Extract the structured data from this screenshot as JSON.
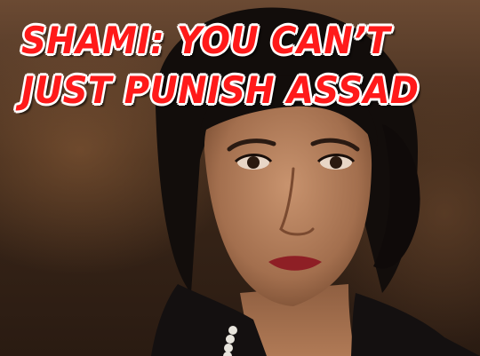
{
  "headline": {
    "line1": "SHAMI: YOU CAN’T",
    "line2": "JUST PUNISH ASSAD"
  },
  "colors": {
    "headline_fill": "#ff1a1a",
    "headline_outline": "#ffffff"
  },
  "photo": {
    "subject": "portrait-photo"
  }
}
